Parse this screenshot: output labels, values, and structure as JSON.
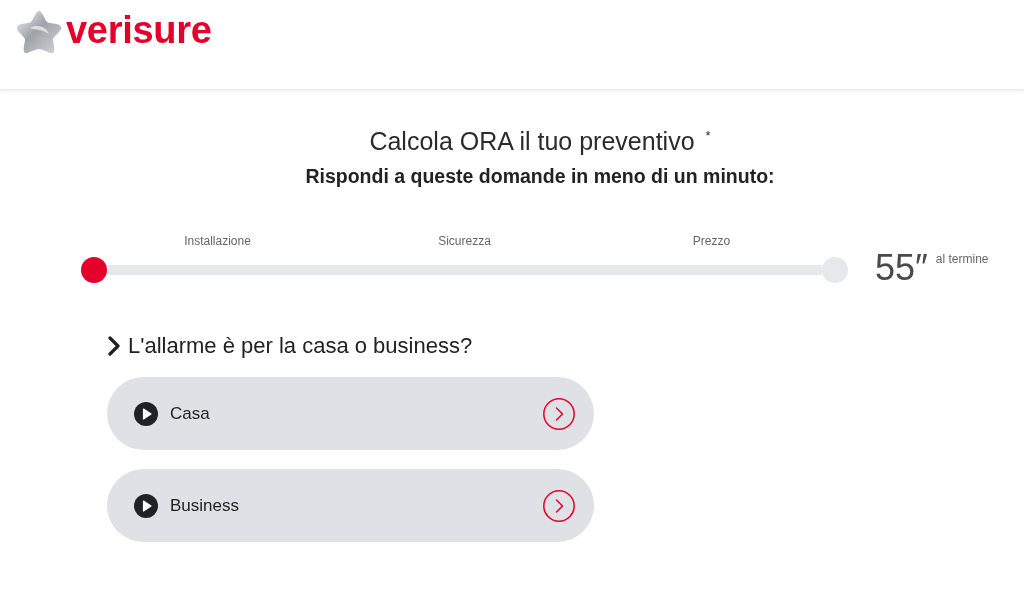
{
  "header": {
    "logo_text": "verisure"
  },
  "title": "Calcola ORA il tuo preventivo $^{*}$",
  "subtitle": "Rispondi a queste domande in meno di un minuto:",
  "progress": {
    "steps": [
      "Installazione",
      "Sicurezza",
      "Prezzo"
    ],
    "level": 0,
    "timer": "55″",
    "timer_caption": "al termine"
  },
  "question": {
    "text": "L'allarme è per la casa o business?",
    "options": [
      {
        "label": "Casa"
      },
      {
        "label": "Business"
      }
    ]
  }
}
